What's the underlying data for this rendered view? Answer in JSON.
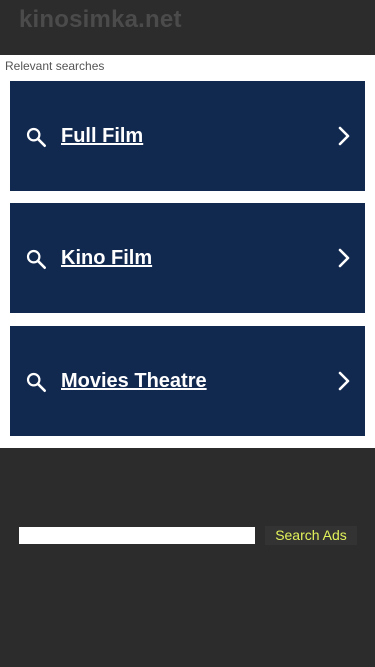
{
  "header": {
    "site_title": "kinosimka.net"
  },
  "content": {
    "section_label": "Relevant searches",
    "results": [
      {
        "label": "Full Film",
        "icon": "search-icon",
        "trailing_icon": "chevron-right-icon"
      },
      {
        "label": "Kino Film",
        "icon": "search-icon",
        "trailing_icon": "chevron-right-icon"
      },
      {
        "label": "Movies Theatre",
        "icon": "search-icon",
        "trailing_icon": "chevron-right-icon"
      }
    ]
  },
  "footer": {
    "search_value": "",
    "search_button_label": "Search Ads"
  },
  "colors": {
    "page_background": "#2c2c2c",
    "result_background": "#11284f",
    "result_text": "#ffffff",
    "button_text": "#e2f25a",
    "title_text": "#4b4b4b"
  }
}
